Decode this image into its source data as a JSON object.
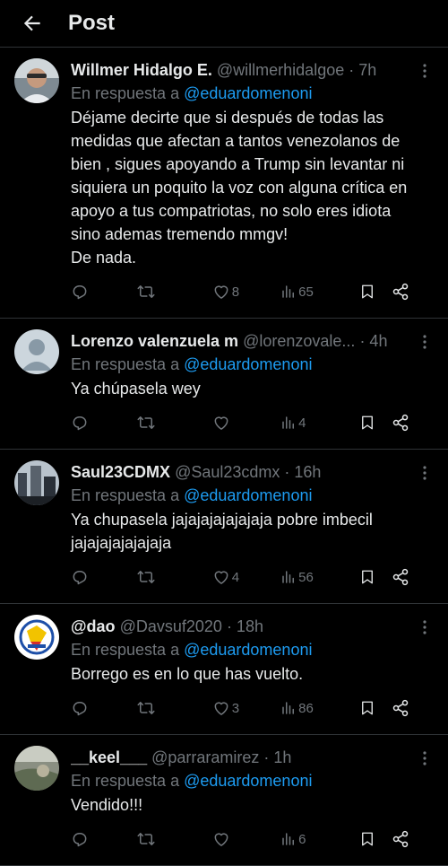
{
  "header": {
    "title": "Post"
  },
  "reply_prefix": "En respuesta a",
  "replies": [
    {
      "name": "Willmer Hidalgo E.",
      "handle": "@willmerhidalgoe",
      "time": "· 7h",
      "reply_to": "@eduardomenoni",
      "text": "Déjame decirte que si después de todas las medidas que afectan a tantos venezolanos de bien , sigues apoyando a Trump sin levantar ni siquiera un poquito la voz con alguna crítica en apoyo a tus compatriotas, no solo eres idiota sino ademas tremendo mmgv!\nDe nada.",
      "likes": "8",
      "views": "65"
    },
    {
      "name": "Lorenzo valenzuela m",
      "handle": "@lorenzovale...",
      "time": "· 4h",
      "reply_to": "@eduardomenoni",
      "text": "Ya chúpasela wey",
      "likes": "",
      "views": "4"
    },
    {
      "name": "Saul23CDMX",
      "handle": "@Saul23cdmx",
      "time": "· 16h",
      "reply_to": "@eduardomenoni",
      "text": "Ya chupasela jajajajajajajaja pobre imbecil jajajajajajajaja",
      "likes": "4",
      "views": "56"
    },
    {
      "name": "@dao",
      "handle": "@Davsuf2020",
      "time": "· 18h",
      "reply_to": "@eduardomenoni",
      "text": "Borrego es en lo que has vuelto.",
      "likes": "3",
      "views": "86"
    },
    {
      "name": "__keel___",
      "handle": "@parraramirez",
      "time": "· 1h",
      "reply_to": "@eduardomenoni",
      "text": "Vendido!!!",
      "likes": "",
      "views": "6"
    }
  ],
  "colors": {
    "background": "#000000",
    "text": "#e7e9ea",
    "muted": "#71767b",
    "link": "#1d9bf0",
    "divider": "#2f3336"
  },
  "icons": {
    "back": "arrow-left-icon",
    "more": "more-vertical-icon",
    "reply": "reply-icon",
    "retweet": "retweet-icon",
    "like": "heart-icon",
    "views": "views-icon",
    "bookmark": "bookmark-icon",
    "share": "share-icon"
  }
}
